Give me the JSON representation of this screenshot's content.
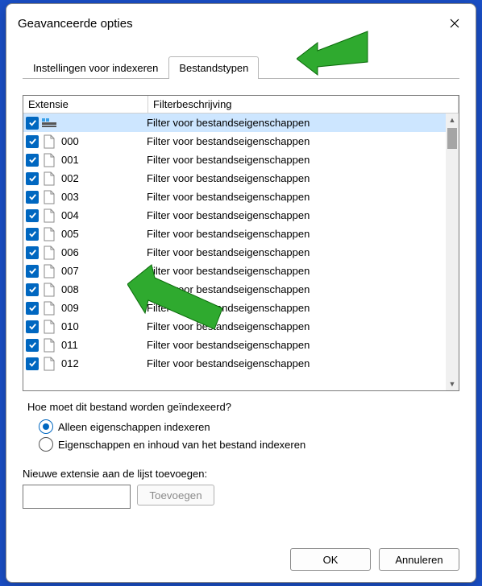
{
  "window": {
    "title": "Geavanceerde opties"
  },
  "tabs": {
    "index": "Instellingen voor indexeren",
    "types": "Bestandstypen"
  },
  "columns": {
    "extension": "Extensie",
    "filter": "Filterbeschrijving"
  },
  "rows": [
    {
      "ext": "",
      "desc": "Filter voor bestandseigenschappen",
      "special": true
    },
    {
      "ext": "000",
      "desc": "Filter voor bestandseigenschappen"
    },
    {
      "ext": "001",
      "desc": "Filter voor bestandseigenschappen"
    },
    {
      "ext": "002",
      "desc": "Filter voor bestandseigenschappen"
    },
    {
      "ext": "003",
      "desc": "Filter voor bestandseigenschappen"
    },
    {
      "ext": "004",
      "desc": "Filter voor bestandseigenschappen"
    },
    {
      "ext": "005",
      "desc": "Filter voor bestandseigenschappen"
    },
    {
      "ext": "006",
      "desc": "Filter voor bestandseigenschappen"
    },
    {
      "ext": "007",
      "desc": "Filter voor bestandseigenschappen"
    },
    {
      "ext": "008",
      "desc": "Filter voor bestandseigenschappen"
    },
    {
      "ext": "009",
      "desc": "Filter voor bestandseigenschappen"
    },
    {
      "ext": "010",
      "desc": "Filter voor bestandseigenschappen"
    },
    {
      "ext": "011",
      "desc": "Filter voor bestandseigenschappen"
    },
    {
      "ext": "012",
      "desc": "Filter voor bestandseigenschappen"
    }
  ],
  "question": "Hoe moet dit bestand worden geïndexeerd?",
  "radios": {
    "properties_only": "Alleen eigenschappen indexeren",
    "properties_content": "Eigenschappen en inhoud van het bestand indexeren"
  },
  "newext": {
    "label": "Nieuwe extensie aan de lijst toevoegen:",
    "value": "",
    "add": "Toevoegen"
  },
  "buttons": {
    "ok": "OK",
    "cancel": "Annuleren"
  }
}
